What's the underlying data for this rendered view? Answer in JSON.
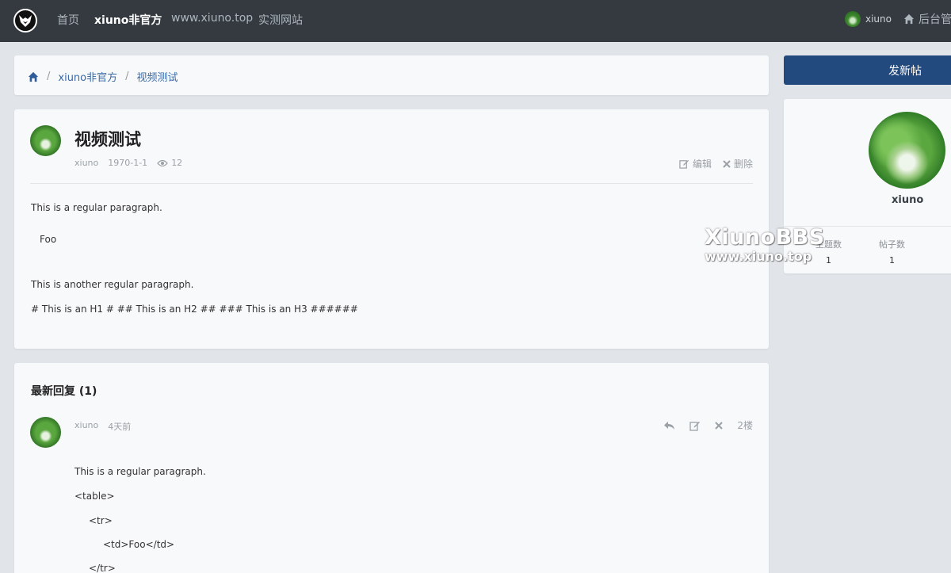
{
  "nav": {
    "items": [
      {
        "label": "首页",
        "active": false
      },
      {
        "label": "xiuno非官方",
        "active": true
      },
      {
        "label": "www.xiuno.top",
        "active": false
      },
      {
        "label": "实测网站",
        "active": false
      }
    ],
    "user": "xiuno",
    "admin": "后台管"
  },
  "breadcrumb": {
    "items": [
      "xiuno非官方",
      "视频测试"
    ]
  },
  "post": {
    "title": "视频测试",
    "author": "xiuno",
    "date": "1970-1-1",
    "views": "12",
    "edit_label": "编辑",
    "delete_label": "删除",
    "paragraphs": [
      "This is a regular paragraph.",
      "Foo",
      "This is another regular paragraph.",
      "# This is an H1 # ## This is an H2 ## ### This is an H3 ######"
    ]
  },
  "replies": {
    "heading": "最新回复 (1)",
    "item": {
      "author": "xiuno",
      "time": "4天前",
      "floor": "2楼",
      "lines": [
        "This is a regular paragraph.",
        "<table>",
        "<tr>",
        "<td>Foo</td>",
        "</tr>"
      ]
    }
  },
  "sidebar": {
    "new_thread_label": "发新帖",
    "profile_name": "xiuno",
    "stats": [
      {
        "label": "主题数",
        "value": "1"
      },
      {
        "label": "帖子数",
        "value": "1"
      }
    ]
  },
  "watermark": {
    "line1": "XiunoBBS",
    "line2": "www.xiuno.top"
  },
  "colors": {
    "topbar": "#343a40",
    "primary": "#234a7e",
    "link": "#3a6aa5"
  }
}
